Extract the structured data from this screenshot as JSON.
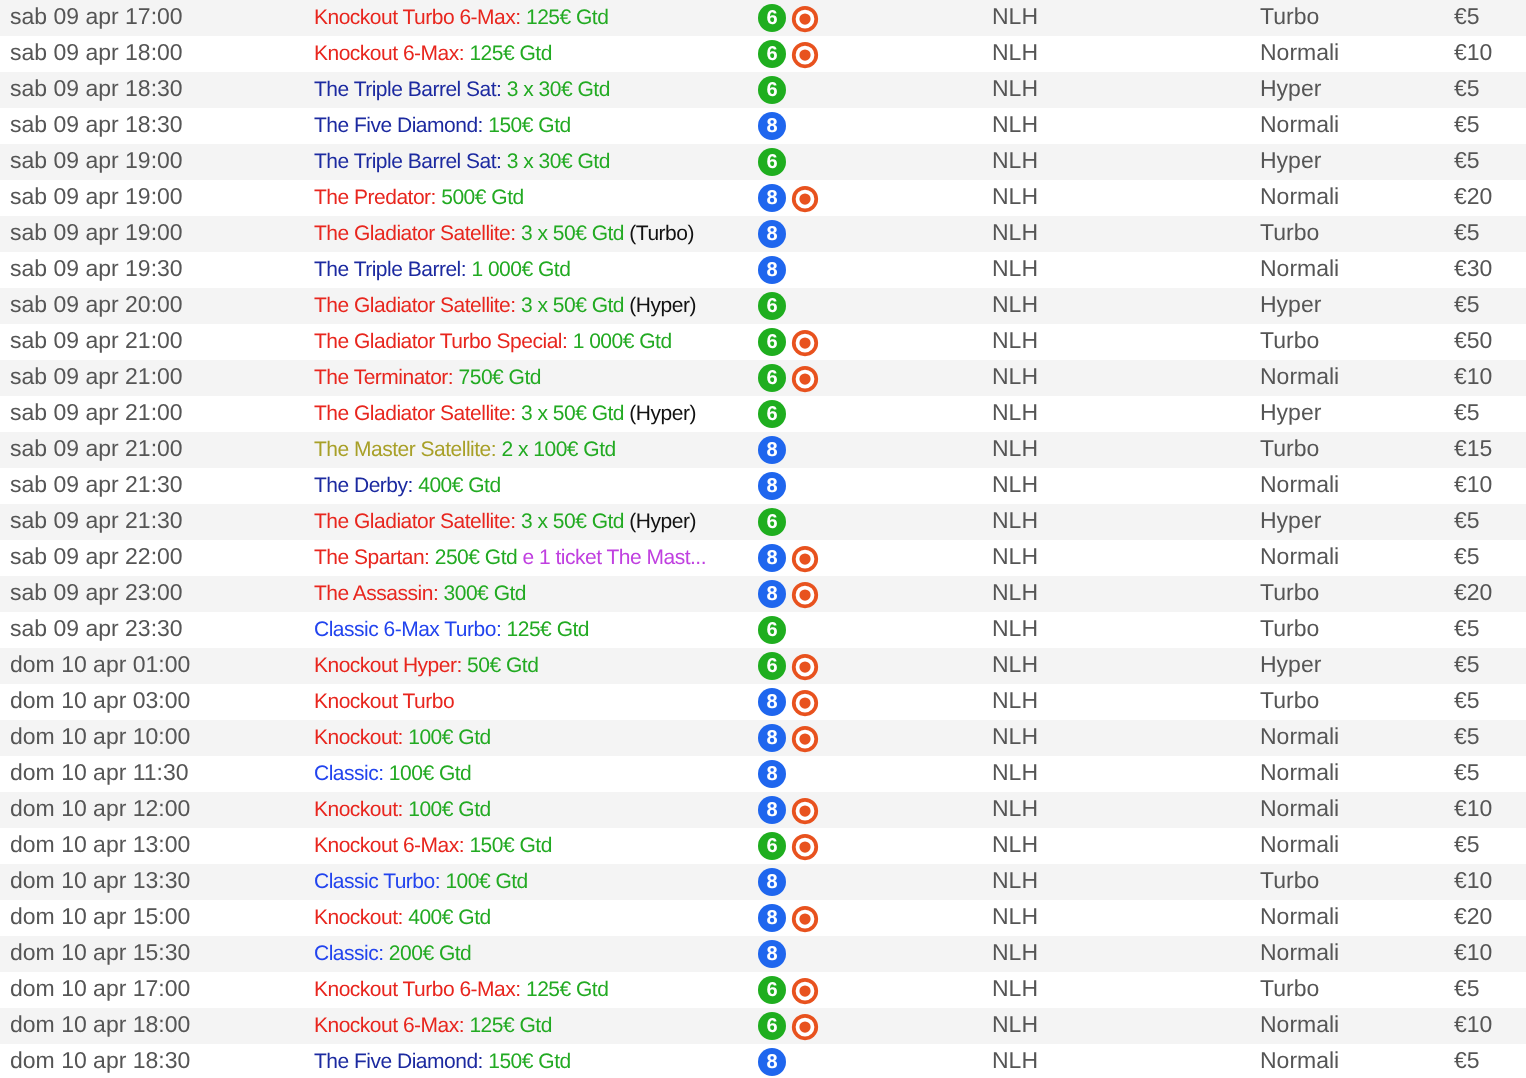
{
  "rows": [
    {
      "date": "sab 09 apr 17:00",
      "title": "Knockout Turbo 6-Max:",
      "color": "#e8261e",
      "prize": "125€ Gtd",
      "seats": {
        "label": "6",
        "color": "#1fae1f"
      },
      "knockout": true,
      "game": "NLH",
      "speed": "Turbo",
      "buyin": "€5"
    },
    {
      "date": "sab 09 apr 18:00",
      "title": "Knockout 6-Max:",
      "color": "#e8261e",
      "prize": "125€ Gtd",
      "seats": {
        "label": "6",
        "color": "#1fae1f"
      },
      "knockout": true,
      "game": "NLH",
      "speed": "Normali",
      "buyin": "€10"
    },
    {
      "date": "sab 09 apr 18:30",
      "title": "The Triple Barrel Sat:",
      "color": "#1c2aa0",
      "prize": "3 x 30€ Gtd",
      "seats": {
        "label": "6",
        "color": "#1fae1f"
      },
      "knockout": false,
      "game": "NLH",
      "speed": "Hyper",
      "buyin": "€5"
    },
    {
      "date": "sab 09 apr 18:30",
      "title": "The Five Diamond:",
      "color": "#1c2aa0",
      "prize": "150€ Gtd",
      "seats": {
        "label": "8",
        "color": "#1f66ee"
      },
      "knockout": false,
      "game": "NLH",
      "speed": "Normali",
      "buyin": "€5"
    },
    {
      "date": "sab 09 apr 19:00",
      "title": "The Triple Barrel Sat:",
      "color": "#1c2aa0",
      "prize": "3 x 30€ Gtd",
      "seats": {
        "label": "6",
        "color": "#1fae1f"
      },
      "knockout": false,
      "game": "NLH",
      "speed": "Hyper",
      "buyin": "€5"
    },
    {
      "date": "sab 09 apr 19:00",
      "title": "The Predator:",
      "color": "#e8261e",
      "prize": "500€ Gtd",
      "seats": {
        "label": "8",
        "color": "#1f66ee"
      },
      "knockout": true,
      "game": "NLH",
      "speed": "Normali",
      "buyin": "€20"
    },
    {
      "date": "sab 09 apr 19:00",
      "title": "The Gladiator Satellite:",
      "color": "#e8261e",
      "prize": "3 x 50€ Gtd",
      "note": "(Turbo)",
      "seats": {
        "label": "8",
        "color": "#1f66ee"
      },
      "knockout": false,
      "game": "NLH",
      "speed": "Turbo",
      "buyin": "€5"
    },
    {
      "date": "sab 09 apr 19:30",
      "title": "The Triple Barrel:",
      "color": "#1c2aa0",
      "prize": "1 000€ Gtd",
      "seats": {
        "label": "8",
        "color": "#1f66ee"
      },
      "knockout": false,
      "game": "NLH",
      "speed": "Normali",
      "buyin": "€30"
    },
    {
      "date": "sab 09 apr 20:00",
      "title": "The Gladiator Satellite:",
      "color": "#e8261e",
      "prize": "3 x 50€ Gtd",
      "note": "(Hyper)",
      "seats": {
        "label": "6",
        "color": "#1fae1f"
      },
      "knockout": false,
      "game": "NLH",
      "speed": "Hyper",
      "buyin": "€5"
    },
    {
      "date": "sab 09 apr 21:00",
      "title": "The Gladiator Turbo Special:",
      "color": "#e8261e",
      "prize": "1 000€ Gtd",
      "seats": {
        "label": "6",
        "color": "#1fae1f"
      },
      "knockout": true,
      "game": "NLH",
      "speed": "Turbo",
      "buyin": "€50"
    },
    {
      "date": "sab 09 apr 21:00",
      "title": "The Terminator:",
      "color": "#e8261e",
      "prize": "750€ Gtd",
      "seats": {
        "label": "6",
        "color": "#1fae1f"
      },
      "knockout": true,
      "game": "NLH",
      "speed": "Normali",
      "buyin": "€10"
    },
    {
      "date": "sab 09 apr 21:00",
      "title": "The Gladiator Satellite:",
      "color": "#e8261e",
      "prize": "3 x 50€ Gtd",
      "note": "(Hyper)",
      "seats": {
        "label": "6",
        "color": "#1fae1f"
      },
      "knockout": false,
      "game": "NLH",
      "speed": "Hyper",
      "buyin": "€5"
    },
    {
      "date": "sab 09 apr 21:00",
      "title": "The Master Satellite:",
      "color": "#a8a028",
      "prize": "2 x 100€ Gtd",
      "seats": {
        "label": "8",
        "color": "#1f66ee"
      },
      "knockout": false,
      "game": "NLH",
      "speed": "Turbo",
      "buyin": "€15"
    },
    {
      "date": "sab 09 apr 21:30",
      "title": "The Derby:",
      "color": "#1c2aa0",
      "prize": "400€ Gtd",
      "seats": {
        "label": "8",
        "color": "#1f66ee"
      },
      "knockout": false,
      "game": "NLH",
      "speed": "Normali",
      "buyin": "€10"
    },
    {
      "date": "sab 09 apr 21:30",
      "title": "The Gladiator Satellite:",
      "color": "#e8261e",
      "prize": "3 x 50€ Gtd",
      "note": "(Hyper)",
      "seats": {
        "label": "6",
        "color": "#1fae1f"
      },
      "knockout": false,
      "game": "NLH",
      "speed": "Hyper",
      "buyin": "€5"
    },
    {
      "date": "sab 09 apr 22:00",
      "title": "The Spartan:",
      "color": "#e8261e",
      "prize": "250€ Gtd",
      "extra": "e 1 ticket The Mast...",
      "seats": {
        "label": "8",
        "color": "#1f66ee"
      },
      "knockout": true,
      "game": "NLH",
      "speed": "Normali",
      "buyin": "€5"
    },
    {
      "date": "sab 09 apr 23:00",
      "title": "The Assassin:",
      "color": "#e8261e",
      "prize": "300€ Gtd",
      "seats": {
        "label": "8",
        "color": "#1f66ee"
      },
      "knockout": true,
      "game": "NLH",
      "speed": "Turbo",
      "buyin": "€20"
    },
    {
      "date": "sab 09 apr 23:30",
      "title": "Classic 6-Max Turbo:",
      "color": "#2244ee",
      "prize": "125€ Gtd",
      "seats": {
        "label": "6",
        "color": "#1fae1f"
      },
      "knockout": false,
      "game": "NLH",
      "speed": "Turbo",
      "buyin": "€5"
    },
    {
      "date": "dom 10 apr 01:00",
      "title": "Knockout Hyper:",
      "color": "#e8261e",
      "prize": "50€ Gtd",
      "seats": {
        "label": "6",
        "color": "#1fae1f"
      },
      "knockout": true,
      "game": "NLH",
      "speed": "Hyper",
      "buyin": "€5"
    },
    {
      "date": "dom 10 apr 03:00",
      "title": "Knockout Turbo",
      "color": "#e8261e",
      "seats": {
        "label": "8",
        "color": "#1f66ee"
      },
      "knockout": true,
      "game": "NLH",
      "speed": "Turbo",
      "buyin": "€5"
    },
    {
      "date": "dom 10 apr 10:00",
      "title": "Knockout:",
      "color": "#e8261e",
      "prize": "100€ Gtd",
      "seats": {
        "label": "8",
        "color": "#1f66ee"
      },
      "knockout": true,
      "game": "NLH",
      "speed": "Normali",
      "buyin": "€5"
    },
    {
      "date": "dom 10 apr 11:30",
      "title": "Classic:",
      "color": "#2244ee",
      "prize": "100€ Gtd",
      "seats": {
        "label": "8",
        "color": "#1f66ee"
      },
      "knockout": false,
      "game": "NLH",
      "speed": "Normali",
      "buyin": "€5"
    },
    {
      "date": "dom 10 apr 12:00",
      "title": "Knockout:",
      "color": "#e8261e",
      "prize": "100€ Gtd",
      "seats": {
        "label": "8",
        "color": "#1f66ee"
      },
      "knockout": true,
      "game": "NLH",
      "speed": "Normali",
      "buyin": "€10"
    },
    {
      "date": "dom 10 apr 13:00",
      "title": "Knockout 6-Max:",
      "color": "#e8261e",
      "prize": "150€ Gtd",
      "seats": {
        "label": "6",
        "color": "#1fae1f"
      },
      "knockout": true,
      "game": "NLH",
      "speed": "Normali",
      "buyin": "€5"
    },
    {
      "date": "dom 10 apr 13:30",
      "title": "Classic Turbo:",
      "color": "#2244ee",
      "prize": "100€ Gtd",
      "seats": {
        "label": "8",
        "color": "#1f66ee"
      },
      "knockout": false,
      "game": "NLH",
      "speed": "Turbo",
      "buyin": "€10"
    },
    {
      "date": "dom 10 apr 15:00",
      "title": "Knockout:",
      "color": "#e8261e",
      "prize": "400€ Gtd",
      "seats": {
        "label": "8",
        "color": "#1f66ee"
      },
      "knockout": true,
      "game": "NLH",
      "speed": "Normali",
      "buyin": "€20"
    },
    {
      "date": "dom 10 apr 15:30",
      "title": "Classic:",
      "color": "#2244ee",
      "prize": "200€ Gtd",
      "seats": {
        "label": "8",
        "color": "#1f66ee"
      },
      "knockout": false,
      "game": "NLH",
      "speed": "Normali",
      "buyin": "€10"
    },
    {
      "date": "dom 10 apr 17:00",
      "title": "Knockout Turbo 6-Max:",
      "color": "#e8261e",
      "prize": "125€ Gtd",
      "seats": {
        "label": "6",
        "color": "#1fae1f"
      },
      "knockout": true,
      "game": "NLH",
      "speed": "Turbo",
      "buyin": "€5"
    },
    {
      "date": "dom 10 apr 18:00",
      "title": "Knockout 6-Max:",
      "color": "#e8261e",
      "prize": "125€ Gtd",
      "seats": {
        "label": "6",
        "color": "#1fae1f"
      },
      "knockout": true,
      "game": "NLH",
      "speed": "Normali",
      "buyin": "€10"
    },
    {
      "date": "dom 10 apr 18:30",
      "title": "The Five Diamond:",
      "color": "#1c2aa0",
      "prize": "150€ Gtd",
      "seats": {
        "label": "8",
        "color": "#1f66ee"
      },
      "knockout": false,
      "game": "NLH",
      "speed": "Normali",
      "buyin": "€5"
    }
  ]
}
